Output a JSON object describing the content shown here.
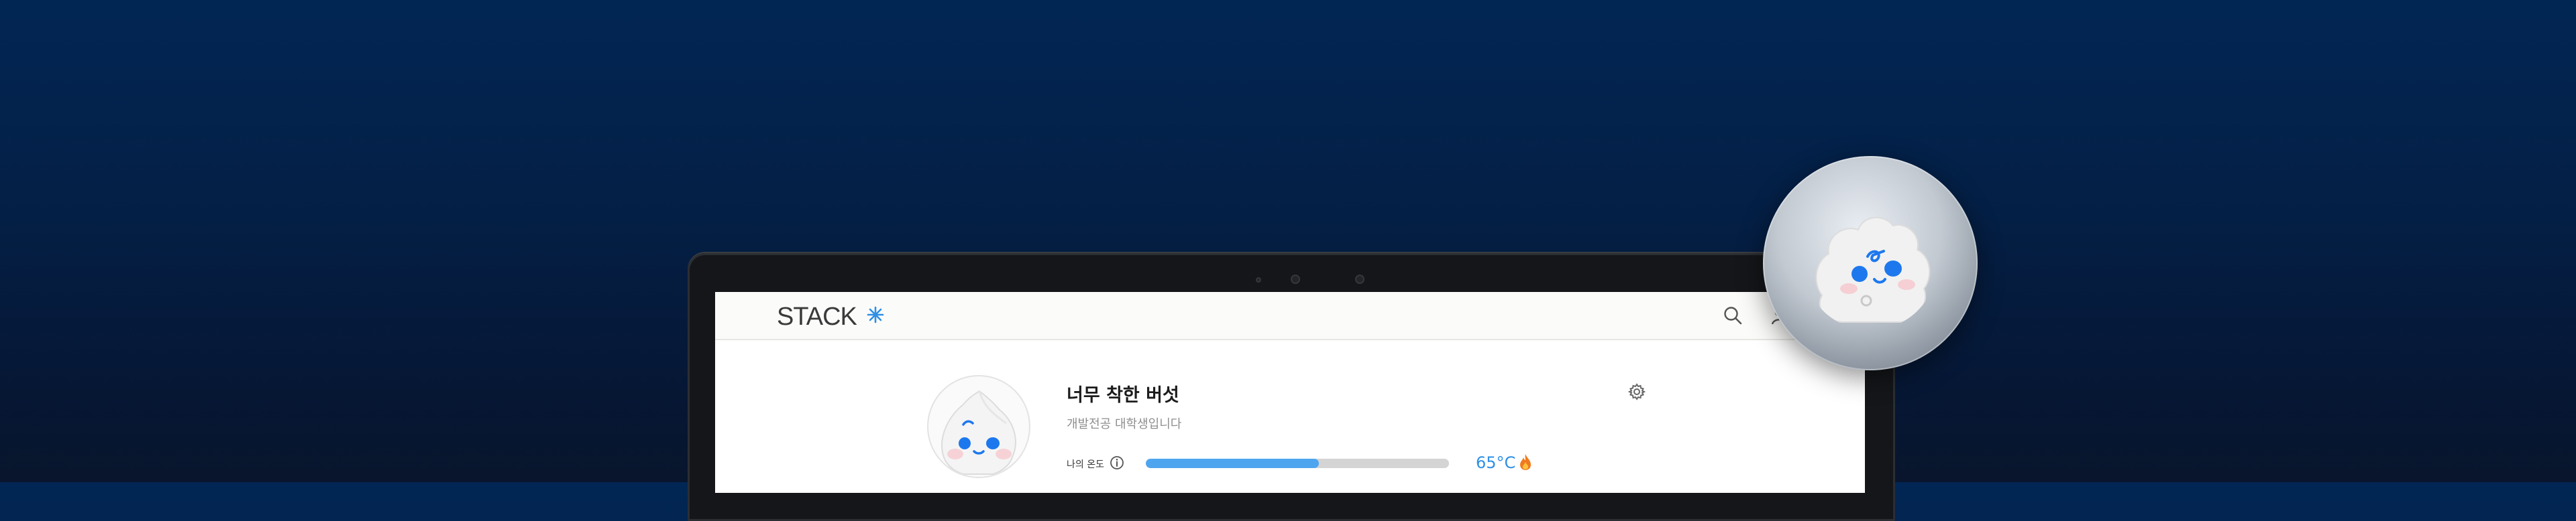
{
  "app": {
    "logo_text": "STACK",
    "logo_icon": "asterisk-star-icon",
    "accent_color": "#2d8fe6",
    "header_icons": [
      "search-icon",
      "profile-icon"
    ]
  },
  "profile": {
    "name": "너무 착한 버섯",
    "description": "개발전공 대학생입니다",
    "avatar_icon": "mushroom-character-icon",
    "settings_icon": "gear-icon"
  },
  "temperature": {
    "label": "나의 온도",
    "info_icon": "info-icon",
    "value_text": "65°C",
    "fill_fraction": 0.57,
    "status_icon": "flame-icon",
    "fill_color": "#4ea5ef"
  },
  "badge": {
    "icon": "cloud-character-icon"
  }
}
